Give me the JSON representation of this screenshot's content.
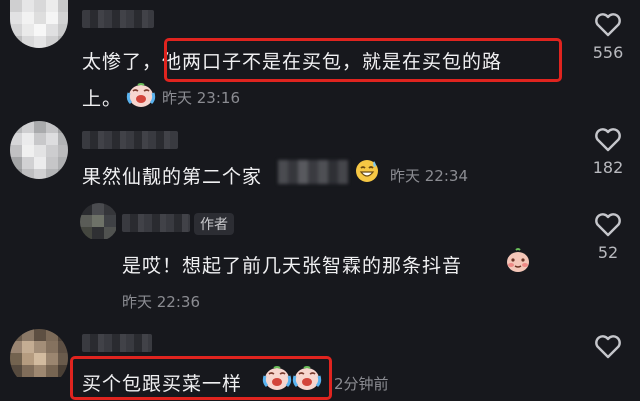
{
  "comments": [
    {
      "line1_plain": "太惨了，",
      "line1_highlight": "他两口子不是在买包，就是在买包的路",
      "line2": "上。",
      "time": "昨天 23:16",
      "likes": "556",
      "emoji": "crying-laughing-face"
    },
    {
      "text": "果然仙靓的第二个家",
      "time": "昨天 22:34",
      "likes": "182",
      "emoji": "grinning-sweat-face"
    },
    {
      "author_tag": "作者",
      "text": "是哎！想起了前几天张智霖的那条抖音",
      "time": "昨天 22:36",
      "likes": "52",
      "emoji": "blushing-face"
    },
    {
      "text": "买个包跟买菜一样",
      "time": "2分钟前",
      "emoji": "crying-laughing-face"
    }
  ],
  "colors": {
    "background": "#17181d",
    "highlight_box": "#e0241f",
    "meta_text": "#8b8c92"
  },
  "icons": {
    "like": "heart-outline-icon"
  }
}
